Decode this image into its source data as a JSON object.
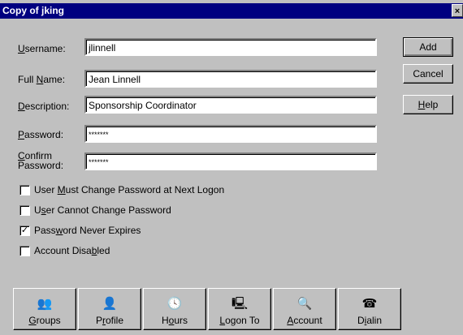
{
  "window": {
    "title": "Copy of jking",
    "close_glyph": "×"
  },
  "form": {
    "username": {
      "label_pre": "",
      "label_u": "U",
      "label_post": "sername:",
      "value": "jlinnell"
    },
    "full_name": {
      "label_pre": "Full ",
      "label_u": "N",
      "label_post": "ame:",
      "value": "Jean Linnell"
    },
    "description": {
      "label_pre": "",
      "label_u": "D",
      "label_post": "escription:",
      "value": "Sponsorship Coordinator"
    },
    "password": {
      "label_pre": "",
      "label_u": "P",
      "label_post": "assword:",
      "value": "*******"
    },
    "confirm": {
      "label_pre": "",
      "label_u": "C",
      "label_post": "onfirm",
      "label_line2": "Password:",
      "value": "*******"
    }
  },
  "checkboxes": [
    {
      "pre": "User ",
      "u": "M",
      "post": "ust Change Password at Next Logon",
      "checked": false,
      "mark": ""
    },
    {
      "pre": "U",
      "u": "s",
      "post": "er Cannot Change Password",
      "checked": false,
      "mark": ""
    },
    {
      "pre": "Pass",
      "u": "w",
      "post": "ord Never Expires",
      "checked": true,
      "mark": "✓"
    },
    {
      "pre": "Account Disa",
      "u": "b",
      "post": "led",
      "checked": false,
      "mark": ""
    }
  ],
  "side_buttons": [
    {
      "pre": "Add",
      "u": "",
      "post": ""
    },
    {
      "pre": "Cancel",
      "u": "",
      "post": ""
    },
    {
      "pre": "",
      "u": "H",
      "post": "elp"
    }
  ],
  "bottom_buttons": [
    {
      "icon": "groups-icon",
      "glyph": "👥",
      "pre": "",
      "u": "G",
      "post": "roups"
    },
    {
      "icon": "profile-icon",
      "glyph": "👤",
      "pre": "P",
      "u": "r",
      "post": "ofile"
    },
    {
      "icon": "clock-icon",
      "glyph": "🕓",
      "pre": "H",
      "u": "o",
      "post": "urs"
    },
    {
      "icon": "logon-to-icon",
      "glyph": "🖳",
      "pre": "",
      "u": "L",
      "post": "ogon To"
    },
    {
      "icon": "account-icon",
      "glyph": "🔍",
      "pre": "",
      "u": "A",
      "post": "ccount"
    },
    {
      "icon": "dialin-icon",
      "glyph": "☎",
      "pre": "D",
      "u": "i",
      "post": "alin"
    }
  ]
}
